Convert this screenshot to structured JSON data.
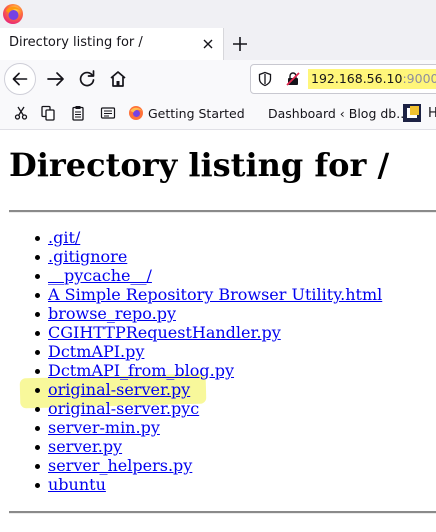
{
  "browser": {
    "tab": {
      "title": "Directory listing for /"
    },
    "url": {
      "host": "192.168.56.10",
      "port": ":9000"
    },
    "bookmarks": [
      {
        "label": "Getting Started",
        "icon": "firefox-icon"
      },
      {
        "label": "Dashboard ‹ Blog db...",
        "icon": "none"
      }
    ],
    "bookmark_overflow_label": "H"
  },
  "page": {
    "heading": "Directory listing for /",
    "entries": [
      ".git/",
      ".gitignore",
      "__pycache__/",
      "A Simple Repository Browser Utility.html",
      "browse_repo.py",
      "CGIHTTPRequestHandler.py",
      "DctmAPI.py",
      "DctmAPI_from_blog.py",
      "original-server.py",
      "original-server.pyc",
      "server-min.py",
      "server.py",
      "server_helpers.py",
      "ubuntu"
    ],
    "highlighted_entry": "original-server.py"
  },
  "colors": {
    "link": "#0000ee",
    "highlight": "#fff67a",
    "chrome_bg": "#f0f0f4"
  }
}
